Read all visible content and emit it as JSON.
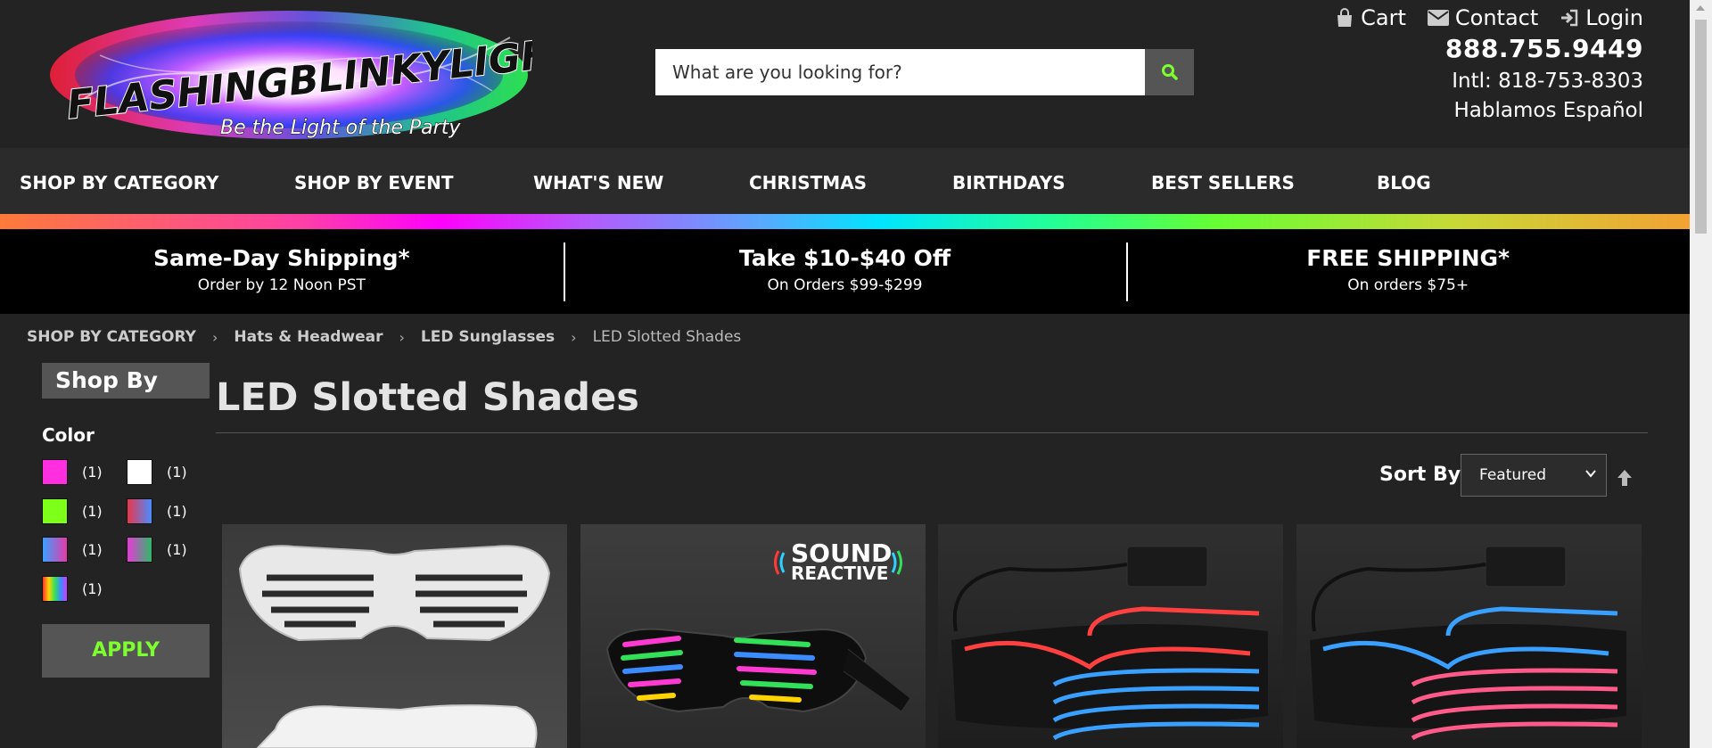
{
  "header": {
    "logo_main": "FLASHINGBLINKYLIGHTS",
    "logo_tagline": "Be the Light of the Party",
    "search": {
      "placeholder": "What are you looking for?"
    },
    "util_links": {
      "cart": "Cart",
      "contact": "Contact",
      "login": "Login"
    },
    "phone": "888.755.9449",
    "intl": "Intl: 818-753-8303",
    "hablamos": "Hablamos Español"
  },
  "nav": {
    "items": [
      "SHOP BY CATEGORY",
      "SHOP BY EVENT",
      "WHAT'S NEW",
      "CHRISTMAS",
      "BIRTHDAYS",
      "BEST SELLERS",
      "BLOG"
    ]
  },
  "promo": [
    {
      "title": "Same-Day Shipping*",
      "sub": "Order by 12 Noon PST"
    },
    {
      "title": "Take $10-$40 Off",
      "sub": "On Orders $99-$299"
    },
    {
      "title": "FREE SHIPPING*",
      "sub": "On orders $75+"
    }
  ],
  "breadcrumb": [
    "SHOP BY CATEGORY",
    "Hats & Headwear",
    "LED Sunglasses",
    "LED Slotted Shades"
  ],
  "sidebar": {
    "shop_by": "Shop By",
    "color_heading": "Color",
    "swatches": [
      {
        "color": "#ff2fe0",
        "count": "(1)"
      },
      {
        "color": "#ffffff",
        "count": "(1)"
      },
      {
        "color": "#7dff1a",
        "count": "(1)"
      },
      {
        "color": "linear-gradient(90deg,#e8364a,#4a8cff)",
        "count": "(1)"
      },
      {
        "color": "linear-gradient(90deg,#3aa0ff,#e63aa8)",
        "count": "(1)"
      },
      {
        "color": "linear-gradient(90deg,#e63ad6,#2fb86a)",
        "count": "(1)"
      },
      {
        "color": "linear-gradient(90deg,#ff3030,#ffd400,#33e05a,#3a8cff,#d43aff)",
        "count": "(1)"
      }
    ],
    "apply": "APPLY"
  },
  "main": {
    "title": "LED Slotted Shades",
    "sort_label": "Sort By",
    "sort_value": "Featured"
  },
  "products": [
    {
      "badge": ""
    },
    {
      "badge_line1": "SOUND",
      "badge_line2": "REACTIVE"
    },
    {
      "badge": ""
    },
    {
      "badge": ""
    }
  ]
}
